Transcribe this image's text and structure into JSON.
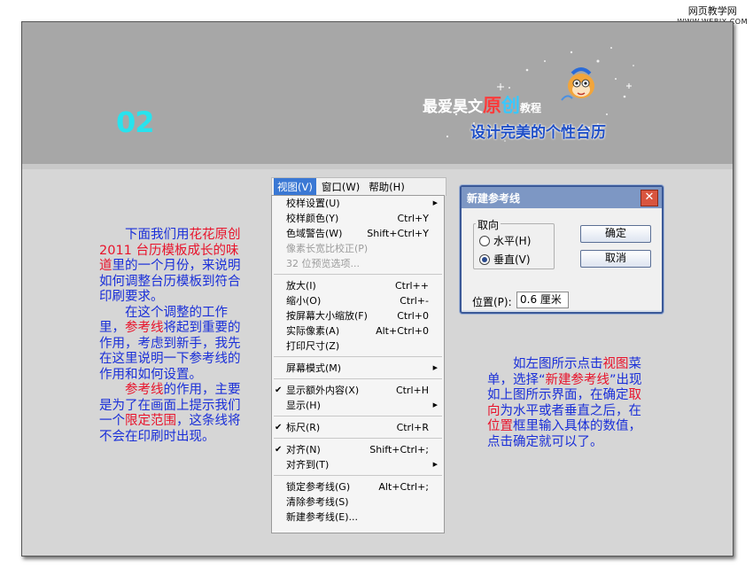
{
  "watermark": {
    "line1": "网页教学网",
    "line2": "WWW.WEBJX.COM"
  },
  "banner": {
    "step_number": "02",
    "logo_prefix": "最爱昊文",
    "logo_char1": "原",
    "logo_char2": "创",
    "logo_suffix": "教程",
    "subtitle": "设计完美的个性台历"
  },
  "menu": {
    "bar": [
      {
        "label": "视图(V)",
        "active": true
      },
      {
        "label": "窗口(W)",
        "active": false
      },
      {
        "label": "帮助(H)",
        "active": false
      }
    ],
    "items": [
      {
        "label": "校样设置(U)",
        "arrow": true
      },
      {
        "label": "校样颜色(Y)",
        "shortcut": "Ctrl+Y"
      },
      {
        "label": "色域警告(W)",
        "shortcut": "Shift+Ctrl+Y"
      },
      {
        "label": "像素长宽比校正(P)",
        "disabled": true
      },
      {
        "label": "32 位预览选项...",
        "disabled": true
      },
      {
        "sep": true
      },
      {
        "label": "放大(I)",
        "shortcut": "Ctrl++"
      },
      {
        "label": "缩小(O)",
        "shortcut": "Ctrl+-"
      },
      {
        "label": "按屏幕大小缩放(F)",
        "shortcut": "Ctrl+0"
      },
      {
        "label": "实际像素(A)",
        "shortcut": "Alt+Ctrl+0"
      },
      {
        "label": "打印尺寸(Z)"
      },
      {
        "sep": true
      },
      {
        "label": "屏幕模式(M)",
        "arrow": true
      },
      {
        "sep": true
      },
      {
        "label": "显示额外内容(X)",
        "shortcut": "Ctrl+H",
        "checked": true
      },
      {
        "label": "显示(H)",
        "arrow": true
      },
      {
        "sep": true
      },
      {
        "label": "标尺(R)",
        "shortcut": "Ctrl+R",
        "checked": true
      },
      {
        "sep": true
      },
      {
        "label": "对齐(N)",
        "shortcut": "Shift+Ctrl+;",
        "checked": true
      },
      {
        "label": "对齐到(T)",
        "arrow": true
      },
      {
        "sep": true
      },
      {
        "label": "锁定参考线(G)",
        "shortcut": "Alt+Ctrl+;"
      },
      {
        "label": "清除参考线(S)"
      },
      {
        "label": "新建参考线(E)..."
      }
    ]
  },
  "dialog": {
    "title": "新建参考线",
    "close": "✕",
    "group_label": "取向",
    "radio_horizontal": "水平(H)",
    "radio_vertical": "垂直(V)",
    "ok": "确定",
    "cancel": "取消",
    "position_label": "位置(P):",
    "position_value": "0.6 厘米"
  },
  "text_left": {
    "p1_a": "下面我们用",
    "p1_b": "花花原创 2011 台历模板成长的味道",
    "p1_c": "里的一个月份，来说明如何调整台历模板到符合印刷要求。",
    "p2_a": "在这个调整的工作里，",
    "p2_b": "参考线",
    "p2_c": "将起到重要的作用，考虑到新手，我先在这里说明一下参考线的作用和如何设置。",
    "p3_a": "参考线",
    "p3_b": "的作用，主要是为了在画面上提示我们一个",
    "p3_c": "限定范围",
    "p3_d": "，这条线将不会在印刷时出现。"
  },
  "text_right": {
    "a": "如左图所示点击",
    "b": "视图",
    "c": "菜单，选择“",
    "d": "新建参考线",
    "e": "”出现如上图所示界面，在确定",
    "f": "取向",
    "g": "为水平或者垂直之后，在",
    "h": "位置",
    "i": "框里输入具体的数值，点击确定就可以了。"
  }
}
